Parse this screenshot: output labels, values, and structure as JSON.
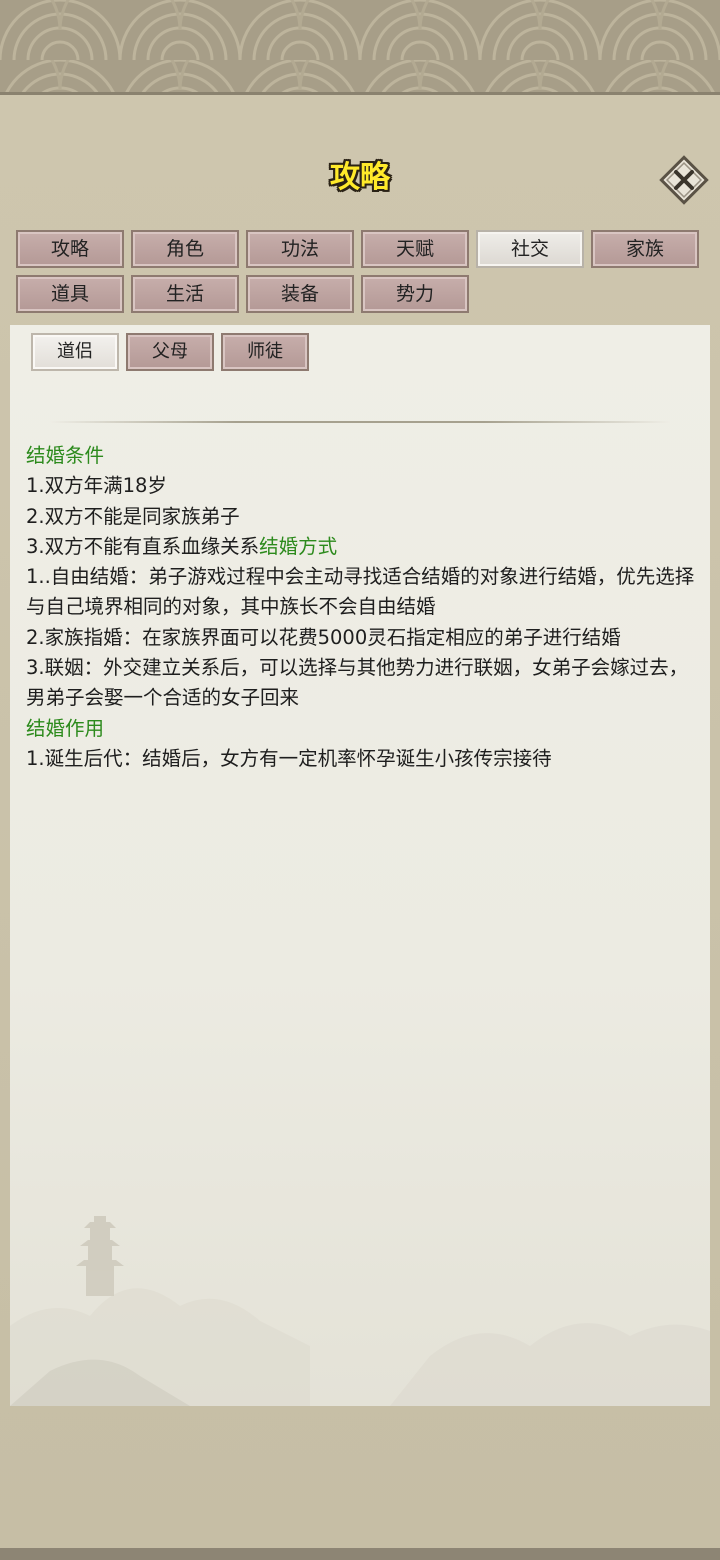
{
  "title": "攻略",
  "close_icon": "close-x-icon",
  "tabs": [
    {
      "label": "攻略",
      "active": false
    },
    {
      "label": "角色",
      "active": false
    },
    {
      "label": "功法",
      "active": false
    },
    {
      "label": "天赋",
      "active": false
    },
    {
      "label": "社交",
      "active": true
    },
    {
      "label": "家族",
      "active": false
    },
    {
      "label": "道具",
      "active": false
    },
    {
      "label": "生活",
      "active": false
    },
    {
      "label": "装备",
      "active": false
    },
    {
      "label": "势力",
      "active": false
    }
  ],
  "subtabs": [
    {
      "label": "道侣",
      "active": true
    },
    {
      "label": "父母",
      "active": false
    },
    {
      "label": "师徒",
      "active": false
    }
  ],
  "guide": {
    "h1": "结婚条件",
    "c1": "1.双方年满18岁",
    "c2": "2.双方不能是同家族弟子",
    "c3": "3.双方不能有直系血缘关系",
    "h2": "结婚方式",
    "m1": "1..自由结婚：弟子游戏过程中会主动寻找适合结婚的对象进行结婚，优先选择与自己境界相同的对象，其中族长不会自由结婚",
    "m2": "2.家族指婚：在家族界面可以花费5000灵石指定相应的弟子进行结婚",
    "m3": "3.联姻：外交建立关系后，可以选择与其他势力进行联姻，女弟子会嫁过去，男弟子会娶一个合适的女子回来",
    "h3": "结婚作用",
    "e1": "1.诞生后代：结婚后，女方有一定机率怀孕诞生小孩传宗接待"
  },
  "colors": {
    "title_yellow": "#ffea2a",
    "heading_green": "#2c8a1c",
    "tab_inactive": "#bda3a0",
    "tab_active": "#e8e5e0"
  }
}
